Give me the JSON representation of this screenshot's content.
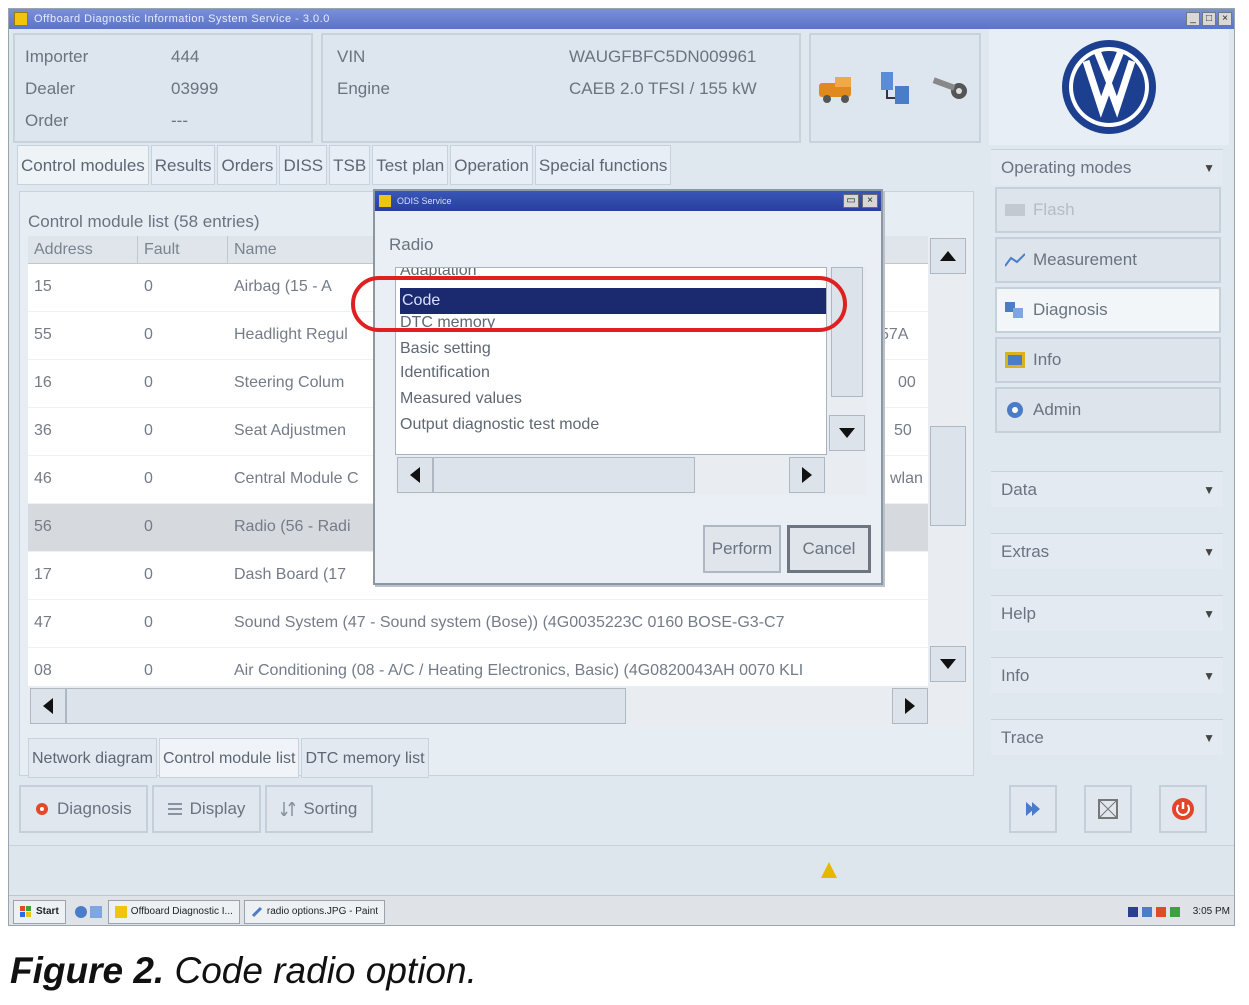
{
  "window": {
    "title": "Offboard Diagnostic Information System Service - 3.0.0"
  },
  "header": {
    "importer_label": "Importer",
    "importer_value": "444",
    "dealer_label": "Dealer",
    "dealer_value": "03999",
    "order_label": "Order",
    "order_value": "---",
    "vin_label": "VIN",
    "vin_value": "WAUGFBFC5DN009961",
    "engine_label": "Engine",
    "engine_value": "CAEB 2.0 TFSI / 155 kW"
  },
  "tabs": [
    "Control modules",
    "Results",
    "Orders",
    "DISS",
    "TSB",
    "Test plan",
    "Operation",
    "Special functions"
  ],
  "main": {
    "caption": "Control module list (58 entries)",
    "columns": [
      "Address",
      "Fault",
      "Name"
    ],
    "rows": [
      {
        "address": "15",
        "fault": "0",
        "name": "Airbag (15 - A",
        "tail": ""
      },
      {
        "address": "55",
        "fault": "0",
        "name": "Headlight Regul",
        "tail": "57A"
      },
      {
        "address": "16",
        "fault": "0",
        "name": "Steering Colum",
        "tail": "00"
      },
      {
        "address": "36",
        "fault": "0",
        "name": "Seat Adjustmen",
        "tail": "50"
      },
      {
        "address": "46",
        "fault": "0",
        "name": "Central Module C",
        "tail": "wlan"
      },
      {
        "address": "56",
        "fault": "0",
        "name": "Radio (56 - Radi",
        "tail": ""
      },
      {
        "address": "17",
        "fault": "0",
        "name": "Dash Board (17",
        "tail": ""
      },
      {
        "address": "47",
        "fault": "0",
        "name": "Sound System (47 - Sound system (Bose)) (4G0035223C   0160   BOSE-G3-C7",
        "tail": ""
      },
      {
        "address": "08",
        "fault": "0",
        "name": "Air Conditioning (08 - A/C / Heating Electronics, Basic) (4G0820043AH   0070   KLI",
        "tail": ""
      }
    ],
    "subtabs": [
      "Network diagram",
      "Control module list",
      "DTC memory list"
    ]
  },
  "actions": [
    "Diagnosis",
    "Display",
    "Sorting"
  ],
  "sidebar": {
    "operating_modes": "Operating modes",
    "modes": [
      "Flash",
      "Measurement",
      "Diagnosis",
      "Info",
      "Admin"
    ],
    "sections": [
      "Data",
      "Extras",
      "Help",
      "Info",
      "Trace"
    ]
  },
  "dialog": {
    "title": "ODIS Service",
    "label": "Radio",
    "items": [
      "Adaptation",
      "Code",
      "DTC memory",
      "Basic setting",
      "Identification",
      "Measured values",
      "Output diagnostic test mode"
    ],
    "perform": "Perform",
    "cancel": "Cancel"
  },
  "taskbar": {
    "start": "Start",
    "task1": "Offboard Diagnostic I...",
    "task2": "radio options.JPG - Paint",
    "clock": "3:05 PM"
  },
  "caption": {
    "label": "Figure 2.",
    "text": "Code radio option."
  },
  "colors": {
    "highlight": "#e02020",
    "selection": "#1b2a6e",
    "titlebar": "#5b74c8"
  }
}
